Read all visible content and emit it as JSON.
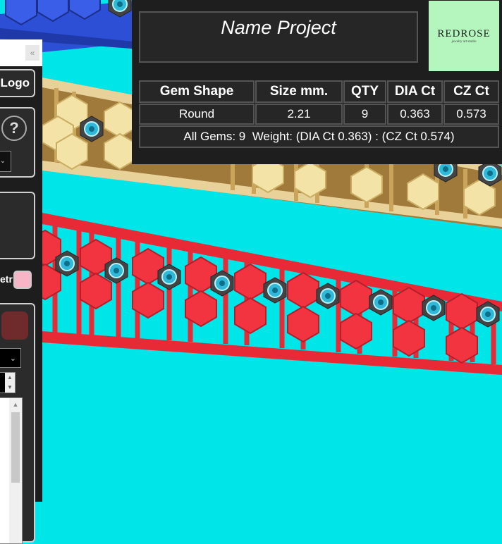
{
  "project": {
    "name": "Name Project"
  },
  "logo": {
    "wordmark": "REDROSE",
    "tagline": "jewelry art studio",
    "bg_color": "#b5f5be"
  },
  "left_panel": {
    "logo_button": "Logo",
    "help_button": "?",
    "metal_label": "etr",
    "swatch_color": "#f7b6c8",
    "accent_color": "#6f2b2b"
  },
  "table": {
    "headers": [
      "Gem Shape",
      "Size mm.",
      "QTY",
      "DIA Ct",
      "CZ Ct"
    ],
    "row": [
      "Round",
      "2.21",
      "9",
      "0.363",
      "0.573"
    ],
    "summary": "All Gems: 9  Weight: (DIA Ct 0.363) : (CZ Ct 0.574)"
  },
  "colors": {
    "background": "#00e5e8",
    "red_metal": "#f0303a",
    "gold_metal": "#d9b36a",
    "blue_metal": "#2d4fd6",
    "gem": "#2fb8d8"
  }
}
